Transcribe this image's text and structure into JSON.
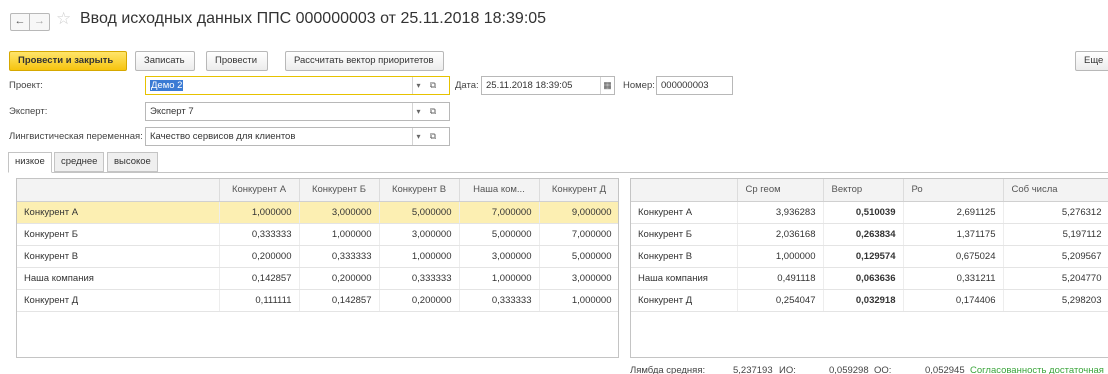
{
  "title": "Ввод исходных данных ППС 000000003 от 25.11.2018 18:39:05",
  "nav": {
    "back": "←",
    "forward": "→",
    "favorite": "☆"
  },
  "toolbar": {
    "post_close": "Провести и закрыть",
    "save": "Записать",
    "post": "Провести",
    "calc": "Рассчитать вектор приоритетов",
    "more": "Еще"
  },
  "form": {
    "project_label": "Проект:",
    "project_value": "Демо 2",
    "date_label": "Дата:",
    "date_value": "25.11.2018 18:39:05",
    "number_label": "Номер:",
    "number_value": "000000003",
    "expert_label": "Эксперт:",
    "expert_value": "Эксперт 7",
    "ling_label": "Лингвистическая переменная:",
    "ling_value": "Качество сервисов для клиентов"
  },
  "tabs": [
    "низкое",
    "среднее",
    "высокое"
  ],
  "matrix": {
    "columns": [
      "Конкурент А",
      "Конкурент Б",
      "Конкурент В",
      "Наша ком...",
      "Конкурент Д"
    ],
    "rows": [
      {
        "name": "Конкурент А",
        "values": [
          "1,000000",
          "3,000000",
          "5,000000",
          "7,000000",
          "9,000000"
        ]
      },
      {
        "name": "Конкурент Б",
        "values": [
          "0,333333",
          "1,000000",
          "3,000000",
          "5,000000",
          "7,000000"
        ]
      },
      {
        "name": "Конкурент В",
        "values": [
          "0,200000",
          "0,333333",
          "1,000000",
          "3,000000",
          "5,000000"
        ]
      },
      {
        "name": "Наша компания",
        "values": [
          "0,142857",
          "0,200000",
          "0,333333",
          "1,000000",
          "3,000000"
        ]
      },
      {
        "name": "Конкурент Д",
        "values": [
          "0,111111",
          "0,142857",
          "0,200000",
          "0,333333",
          "1,000000"
        ]
      }
    ]
  },
  "results": {
    "columns": [
      "Ср геом",
      "Вектор",
      "Ро",
      "Соб числа"
    ],
    "rows": [
      {
        "name": "Конкурент А",
        "values": [
          "3,936283",
          "0,510039",
          "2,691125",
          "5,276312"
        ]
      },
      {
        "name": "Конкурент Б",
        "values": [
          "2,036168",
          "0,263834",
          "1,371175",
          "5,197112"
        ]
      },
      {
        "name": "Конкурент В",
        "values": [
          "1,000000",
          "0,129574",
          "0,675024",
          "5,209567"
        ]
      },
      {
        "name": "Наша компания",
        "values": [
          "0,491118",
          "0,063636",
          "0,331211",
          "5,204770"
        ]
      },
      {
        "name": "Конкурент Д",
        "values": [
          "0,254047",
          "0,032918",
          "0,174406",
          "5,298203"
        ]
      }
    ]
  },
  "summary": {
    "lambda_label": "Лямбда средняя:",
    "lambda_value": "5,237193",
    "io_label": "ИО:",
    "io_value": "0,059298",
    "oo_label": "ОО:",
    "oo_value": "0,052945",
    "status": "Согласованность достаточная"
  }
}
